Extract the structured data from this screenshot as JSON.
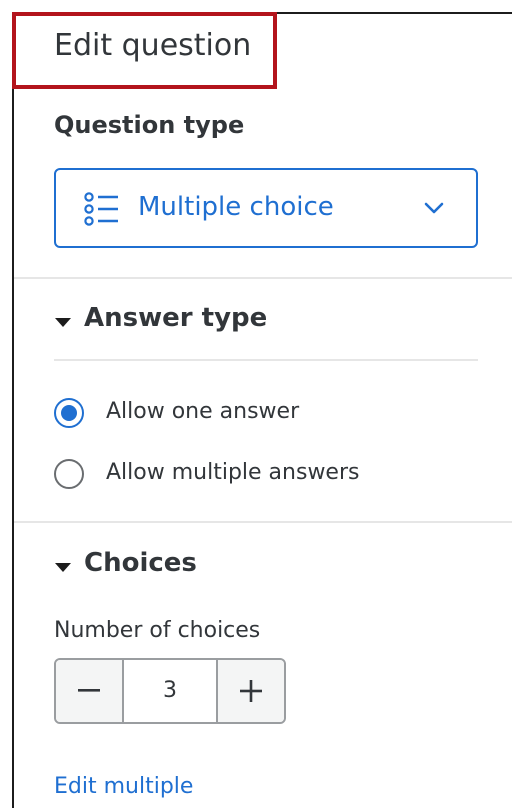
{
  "panel": {
    "title": "Edit question"
  },
  "question_type": {
    "label": "Question type",
    "selected": "Multiple choice",
    "icon": "list-icon"
  },
  "answer_type": {
    "title": "Answer type",
    "options": [
      {
        "label": "Allow one answer",
        "checked": true
      },
      {
        "label": "Allow multiple answers",
        "checked": false
      }
    ]
  },
  "choices": {
    "title": "Choices",
    "number_label": "Number of choices",
    "number_value": "3",
    "edit_multiple_label": "Edit multiple"
  },
  "colors": {
    "accent": "#1f6fd1",
    "highlight_border": "#b3141c",
    "text": "#32363a"
  }
}
